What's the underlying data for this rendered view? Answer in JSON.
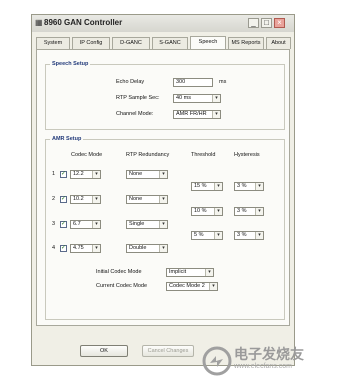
{
  "window": {
    "title": "8960 GAN Controller",
    "icon": "app-icon",
    "controls": [
      "_",
      "□",
      "×"
    ]
  },
  "tabs": [
    {
      "label": "System",
      "active": false
    },
    {
      "label": "IP Config",
      "active": false
    },
    {
      "label": "D-GANC",
      "active": false
    },
    {
      "label": "S-GANC",
      "active": false
    },
    {
      "label": "Speech",
      "active": true
    },
    {
      "label": "MS Reports",
      "active": false
    },
    {
      "label": "About",
      "active": false
    }
  ],
  "speech_setup": {
    "title": "Speech Setup",
    "echo_delay_label": "Echo Delay",
    "echo_delay_value": "300",
    "echo_delay_unit": "ms",
    "rtp_sample_label": "RTP Sample Sec:",
    "rtp_sample_value": "40 ms",
    "channel_mode_label": "Channel Mode:",
    "channel_mode_value": "AMR FR/HR"
  },
  "amr_setup": {
    "title": "AMR Setup",
    "headers": {
      "codec_mode": "Codec Mode",
      "rtp_redundancy": "RTP Redundancy",
      "threshold": "Threshold",
      "hysteresis": "Hysteresis"
    },
    "rows": [
      {
        "index": "1",
        "checked": true,
        "codec": "12.2",
        "redundancy": "None"
      },
      {
        "index": "2",
        "checked": true,
        "codec": "10.2",
        "redundancy": "None"
      },
      {
        "index": "3",
        "checked": true,
        "codec": "6.7",
        "redundancy": "Single"
      },
      {
        "index": "4",
        "checked": true,
        "codec": "4.75",
        "redundancy": "Double"
      }
    ],
    "thresholds": [
      {
        "threshold": "15 %",
        "hysteresis": "3 %"
      },
      {
        "threshold": "10 %",
        "hysteresis": "3 %"
      },
      {
        "threshold": "5 %",
        "hysteresis": "3 %"
      }
    ],
    "initial_codec_label": "Initial Codec Mode",
    "initial_codec_value": "Implicit",
    "current_codec_label": "Current Codec Mode",
    "current_codec_value": "Codec Mode 2"
  },
  "footer": {
    "ok_label": "OK",
    "cancel_label": "Cancel Changes"
  },
  "watermark": {
    "main": "电子发烧友",
    "sub": "www.elecfans.com"
  }
}
